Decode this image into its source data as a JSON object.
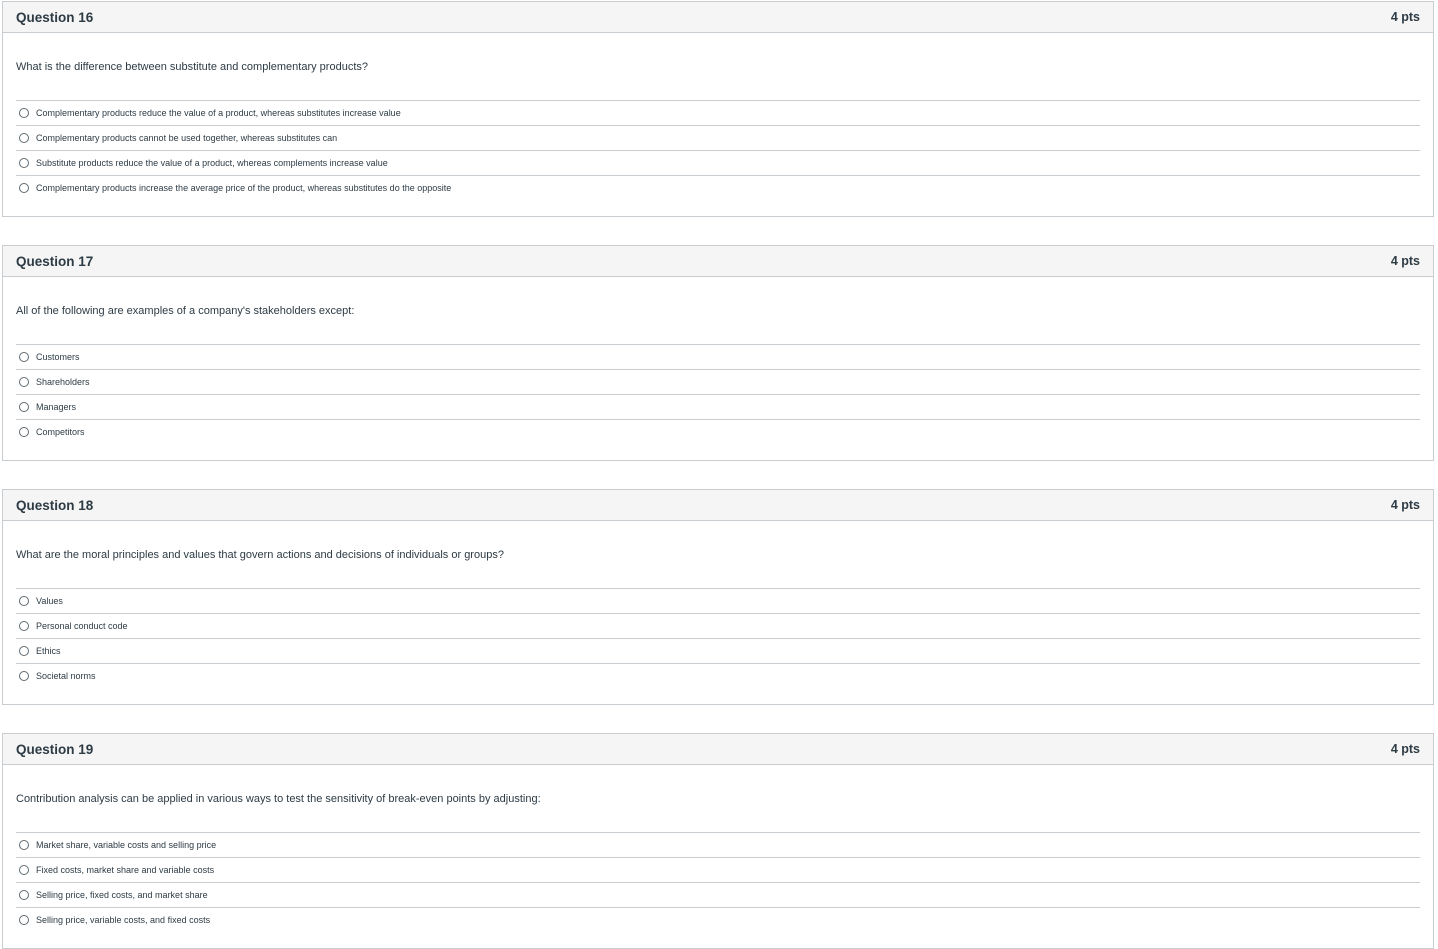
{
  "questions": [
    {
      "title": "Question 16",
      "points": "4 pts",
      "text": "What is the difference between substitute and complementary products?",
      "answers": [
        "Complementary products reduce the value of a product, whereas substitutes increase value",
        "Complementary products cannot be used together, whereas substitutes can",
        "Substitute products reduce the value of a product, whereas complements increase value",
        "Complementary products increase the average price of the product, whereas substitutes do the opposite"
      ]
    },
    {
      "title": "Question 17",
      "points": "4 pts",
      "text": "All of the following are examples of a company's stakeholders except:",
      "answers": [
        "Customers",
        "Shareholders",
        "Managers",
        "Competitors"
      ]
    },
    {
      "title": "Question 18",
      "points": "4 pts",
      "text": "What are the moral principles and values that govern actions and decisions of individuals or groups?",
      "answers": [
        "Values",
        "Personal conduct code",
        "Ethics",
        "Societal norms"
      ]
    },
    {
      "title": "Question 19",
      "points": "4 pts",
      "text": "Contribution analysis can be applied in various ways to test the sensitivity of break-even points by adjusting:",
      "answers": [
        "Market share, variable costs and selling price",
        "Fixed costs, market share and variable costs",
        "Selling price, fixed costs, and market share",
        "Selling price, variable costs, and fixed costs"
      ]
    }
  ],
  "icons": {
    "radio": "radio-unselected-icon"
  },
  "colors": {
    "header_bg": "#f5f5f5",
    "border": "#c7cdd1",
    "text": "#2d3b45"
  }
}
